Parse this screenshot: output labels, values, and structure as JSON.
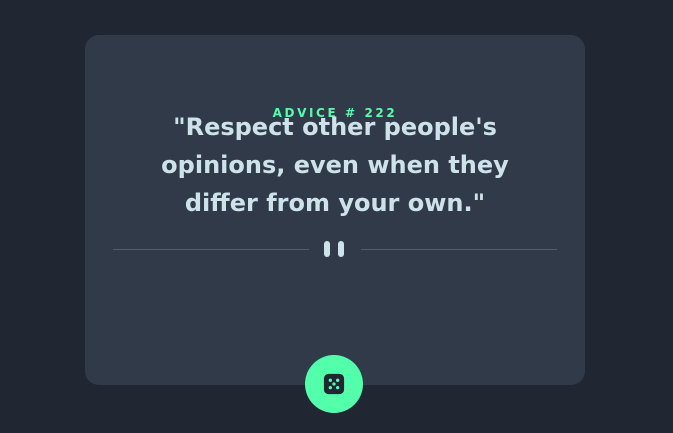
{
  "card": {
    "advice_id": "ADVICE # 222",
    "quote_lines": [
      "\"Respect other people's",
      "opinions, even when they",
      "differ from your own.\""
    ]
  },
  "icons": {
    "divider": "pause-icon",
    "button": "dice-icon"
  },
  "colors": {
    "background": "#202632",
    "card": "#313a49",
    "accent": "#53ffaa",
    "text": "#cee3e9",
    "divider": "#4f5d73"
  }
}
